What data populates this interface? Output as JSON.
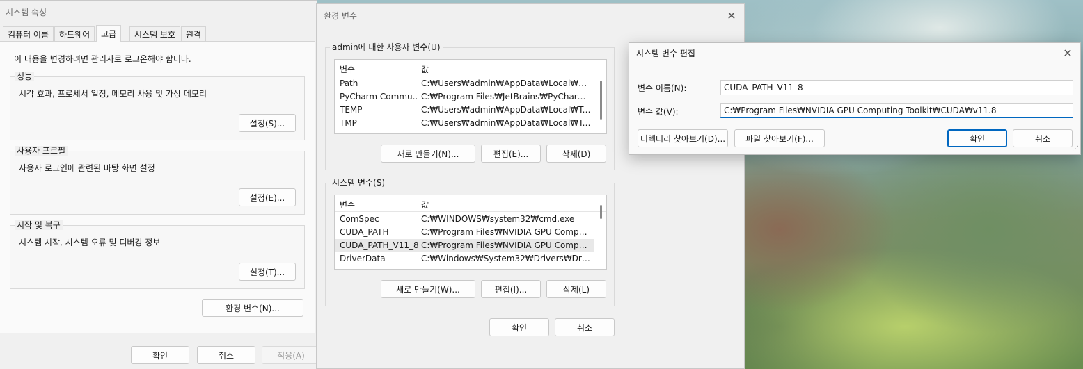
{
  "system_properties": {
    "title": "시스템 속성",
    "tabs": [
      "컴퓨터 이름",
      "하드웨어",
      "고급",
      "시스템 보호",
      "원격"
    ],
    "admin_notice": "이 내용을 변경하려면 관리자로 로그온해야 합니다.",
    "performance": {
      "title": "성능",
      "desc": "시각 효과, 프로세서 일정, 메모리 사용 및 가상 메모리",
      "button": "설정(S)..."
    },
    "user_profiles": {
      "title": "사용자 프로필",
      "desc": "사용자 로그인에 관련된 바탕 화면 설정",
      "button": "설정(E)..."
    },
    "startup_recovery": {
      "title": "시작 및 복구",
      "desc": "시스템 시작, 시스템 오류 및 디버깅 정보",
      "button": "설정(T)..."
    },
    "env_button": "환경 변수(N)...",
    "ok": "확인",
    "cancel": "취소",
    "apply": "적용(A)"
  },
  "env_vars": {
    "title": "환경 변수",
    "user_group_title": "admin에 대한 사용자 변수(U)",
    "col_name": "변수",
    "col_value": "값",
    "user_rows": [
      {
        "name": "Path",
        "value": "C:₩Users₩admin₩AppData₩Local₩Micros..."
      },
      {
        "name": "PyCharm Commu...",
        "value": "C:₩Program Files₩JetBrains₩PyCharm Co..."
      },
      {
        "name": "TEMP",
        "value": "C:₩Users₩admin₩AppData₩Local₩Temp"
      },
      {
        "name": "TMP",
        "value": "C:₩Users₩admin₩AppData₩Local₩Temp"
      }
    ],
    "user_new": "새로 만들기(N)...",
    "user_edit": "편집(E)...",
    "user_delete": "삭제(D)",
    "system_group_title": "시스템 변수(S)",
    "system_rows": [
      {
        "name": "ComSpec",
        "value": "C:₩WINDOWS₩system32₩cmd.exe"
      },
      {
        "name": "CUDA_PATH",
        "value": "C:₩Program Files₩NVIDIA GPU Computing..."
      },
      {
        "name": "CUDA_PATH_V11_8",
        "value": "C:₩Program Files₩NVIDIA GPU Computing..."
      },
      {
        "name": "DriverData",
        "value": "C:₩Windows₩System32₩Drivers₩DriverData"
      }
    ],
    "system_new": "새로 만들기(W)...",
    "system_edit": "편집(I)...",
    "system_delete": "삭제(L)",
    "ok": "확인",
    "cancel": "취소"
  },
  "edit_dialog": {
    "title": "시스템 변수 편집",
    "name_label": "변수 이름(N):",
    "name_value": "CUDA_PATH_V11_8",
    "value_label": "변수 값(V):",
    "value_value": "C:₩Program Files₩NVIDIA GPU Computing Toolkit₩CUDA₩v11.8",
    "browse_dir": "디렉터리 찾아보기(D)...",
    "browse_file": "파일 찾아보기(F)...",
    "ok": "확인",
    "cancel": "취소"
  }
}
